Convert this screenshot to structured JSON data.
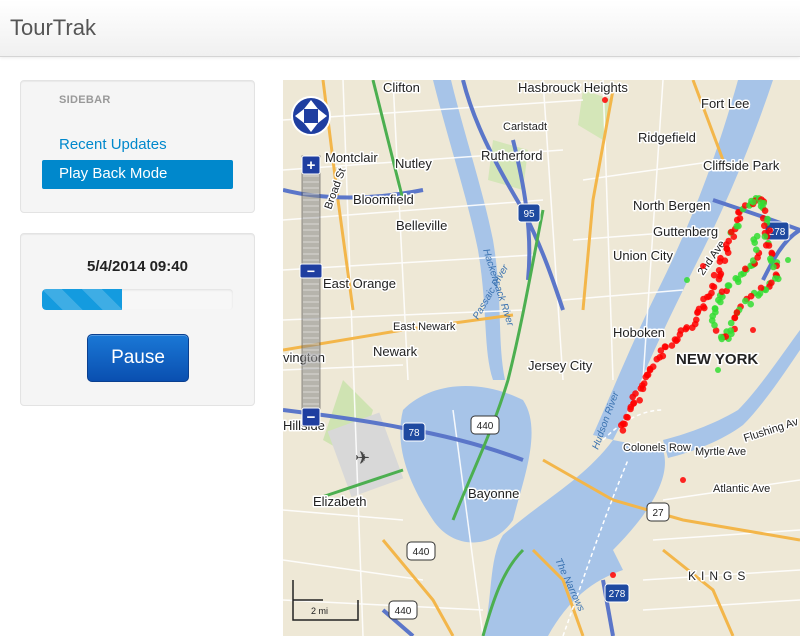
{
  "app": {
    "brand": "TourTrak"
  },
  "sidebar": {
    "header": "SIDEBAR",
    "items": [
      {
        "label": "Recent Updates",
        "active": false
      },
      {
        "label": "Play Back Mode",
        "active": true
      }
    ]
  },
  "playback": {
    "datetime": "5/4/2014 09:40",
    "progress": 0.42,
    "pause_label": "Pause"
  },
  "map": {
    "place_labels": [
      "Clifton",
      "Hasbrouck Heights",
      "Fort Lee",
      "Carlstadt",
      "Ridgefield",
      "Cliffside Park",
      "Montclair",
      "Nutley",
      "Rutherford",
      "Bloomfield",
      "North Bergen",
      "Guttenberg",
      "Belleville",
      "Union City",
      "East Orange",
      "East Newark",
      "Hoboken",
      "Newark",
      "NEW YORK",
      "Jersey City",
      "Bayonne",
      "Elizabeth",
      "Atlantic Ave",
      "Myrtle Ave",
      "Flushing Av",
      "Colonels Row",
      "KINGS",
      "2nd Ave",
      "Hillside",
      "vington",
      "Broad St"
    ],
    "water_labels": [
      "Hackensack River",
      "Passaic River",
      "Hudson River",
      "The Narrows"
    ],
    "route_shields": [
      "95",
      "278",
      "78",
      "440",
      "27",
      "278",
      "440",
      "440"
    ],
    "scale_label": "2 mi",
    "track_colors": {
      "start": "#ff0000",
      "finish": "#33dd33"
    },
    "zoom_controls": {
      "in": "+",
      "out": "−"
    }
  }
}
